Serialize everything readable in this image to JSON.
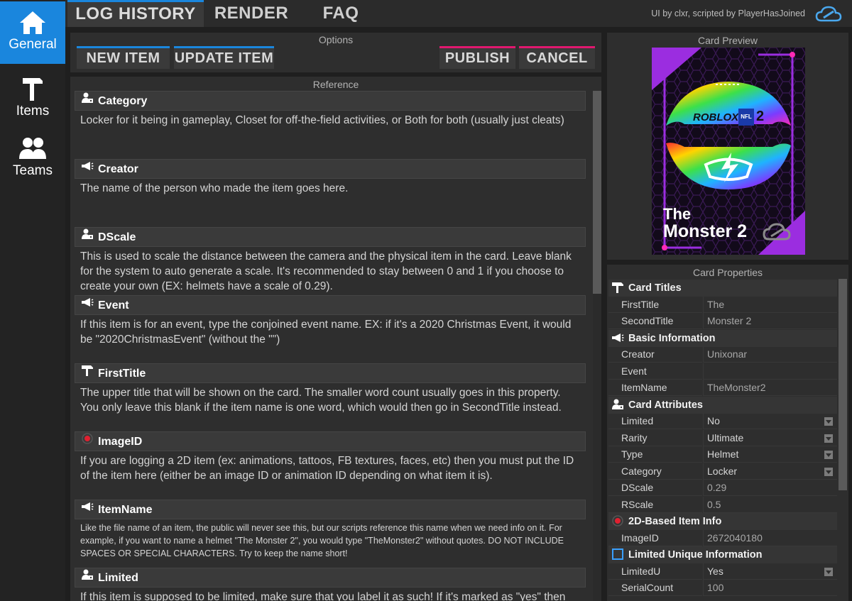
{
  "sidebar": {
    "items": [
      {
        "label": "General",
        "icon": "home-icon",
        "active": true
      },
      {
        "label": "Items",
        "icon": "hammer-icon",
        "active": false
      },
      {
        "label": "Teams",
        "icon": "users-icon",
        "active": false
      }
    ]
  },
  "topbar": {
    "tabs": [
      {
        "label": "LOG HISTORY",
        "active": true
      },
      {
        "label": "RENDER",
        "active": false
      },
      {
        "label": "FAQ",
        "active": false
      }
    ],
    "credit": "UI by clxr, scripted by PlayerHasJoined",
    "credit_icon": "cloud-icon"
  },
  "options": {
    "title": "Options",
    "new_item": "NEW ITEM",
    "update_item": "UPDATE ITEM",
    "publish": "PUBLISH",
    "cancel": "CANCEL"
  },
  "reference": {
    "title": "Reference",
    "items": [
      {
        "title": "Category",
        "icon": "person-tag-icon",
        "desc": "Locker for it being in gameplay, Closet for off-the-field activities, or Both for both (usually just cleats)"
      },
      {
        "title": "Creator",
        "icon": "megaphone-icon",
        "desc": "The name of the person who made the item goes here."
      },
      {
        "title": "DScale",
        "icon": "person-tag-icon",
        "desc": "This is used to scale the distance between the camera and the physical item in the card. Leave blank for the system to auto generate a scale. It's recommended to stay between 0 and 1 if you choose to create your own (EX: helmets have a scale of 0.29)."
      },
      {
        "title": "Event",
        "icon": "megaphone-icon",
        "desc": "If this item is for an event, type the conjoined event name. EX: if it's a 2020 Christmas Event, it would be \"2020ChristmasEvent\" (without the \"\")"
      },
      {
        "title": "FirstTitle",
        "icon": "title-icon",
        "desc": "The upper title that will be shown on the card. The smaller word count usually goes in this property. You only leave this blank if the item name is one word, which would then go in SecondTitle instead."
      },
      {
        "title": "ImageID",
        "icon": "record-icon",
        "desc": "If you are logging a 2D item (ex: animations, tattoos, FB textures, faces, etc) then you must put the ID of the item here (either be an image ID or animation ID depending on what item  it is)."
      },
      {
        "title": "ItemName",
        "icon": "megaphone-icon",
        "desc": "Like the file name of an item, the public will never see this, but our scripts reference this name when we need info on it. For example, if you want to name a helmet \"The Monster 2\", you would type \"TheMonster2\" without quotes. DO NOT INCLUDE SPACES OR SPECIAL CHARACTERS. Try to keep the name short!"
      },
      {
        "title": "Limited",
        "icon": "person-tag-icon",
        "desc": "If this item is supposed to be limited, make sure that you label it as such! If it's marked as \"yes\" then"
      }
    ]
  },
  "preview": {
    "title": "Card Preview",
    "logo_text": "ROBLOX",
    "logo_badge": "NFL",
    "logo_number": "2",
    "first_title": "The",
    "second_title": "Monster 2"
  },
  "properties": {
    "title": "Card Properties",
    "sections": [
      {
        "title": "Card Titles",
        "icon": "title-icon",
        "rows": [
          {
            "key": "FirstTitle",
            "value": "The",
            "dropdown": false
          },
          {
            "key": "SecondTitle",
            "value": "Monster 2",
            "dropdown": false
          }
        ]
      },
      {
        "title": "Basic Information",
        "icon": "megaphone-icon",
        "rows": [
          {
            "key": "Creator",
            "value": "Unixonar",
            "dropdown": false
          },
          {
            "key": "Event",
            "value": "",
            "dropdown": false
          },
          {
            "key": "ItemName",
            "value": "TheMonster2",
            "dropdown": false
          }
        ]
      },
      {
        "title": "Card Attributes",
        "icon": "person-tag-icon",
        "rows": [
          {
            "key": "Limited",
            "value": "No",
            "dropdown": true
          },
          {
            "key": "Rarity",
            "value": "Ultimate",
            "dropdown": true
          },
          {
            "key": "Type",
            "value": "Helmet",
            "dropdown": true
          },
          {
            "key": "Category",
            "value": "Locker",
            "dropdown": true
          },
          {
            "key": "DScale",
            "value": "0.29",
            "dropdown": false
          },
          {
            "key": "RScale",
            "value": "0.5",
            "dropdown": false
          }
        ]
      },
      {
        "title": "2D-Based Item Info",
        "icon": "record-icon",
        "rows": [
          {
            "key": "ImageID",
            "value": "2672040180",
            "dropdown": false
          }
        ]
      },
      {
        "title": "Limited Unique Information",
        "icon": "square-icon",
        "rows": [
          {
            "key": "LimitedU",
            "value": "Yes",
            "dropdown": true
          },
          {
            "key": "SerialCount",
            "value": "100",
            "dropdown": false
          }
        ]
      }
    ]
  },
  "colors": {
    "accent_blue": "#1a86dd",
    "accent_pink": "#e0186f",
    "card_purple": "#9b2de0"
  }
}
